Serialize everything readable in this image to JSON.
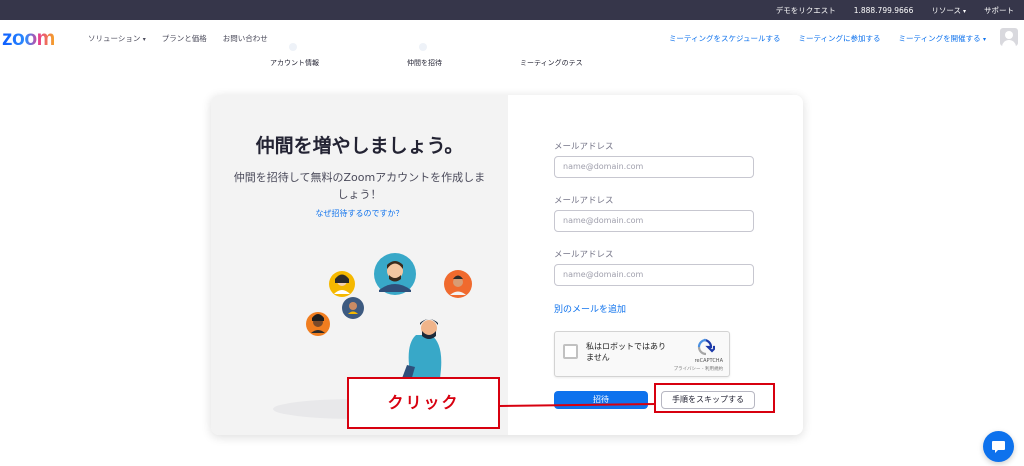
{
  "topbar": {
    "demo": "デモをリクエスト",
    "phone": "1.888.799.9666",
    "resources": "リソース",
    "support": "サポート"
  },
  "nav": {
    "logo": "zoom",
    "left": [
      "ソリューション",
      "プランと価格",
      "お問い合わせ"
    ],
    "right": [
      "ミーティングをスケジュールする",
      "ミーティングに参加する",
      "ミーティングを開催する"
    ]
  },
  "steps": [
    "アカウント情報",
    "仲間を招待",
    "ミーティングのテス"
  ],
  "invite": {
    "headline": "仲間を増やしましょう。",
    "subline": "仲間を招待して無料のZoomアカウントを作成しましょう！",
    "why_link": "なぜ招待するのですか？"
  },
  "form": {
    "fields": [
      {
        "label": "メールアドレス",
        "placeholder": "name@domain.com"
      },
      {
        "label": "メールアドレス",
        "placeholder": "name@domain.com"
      },
      {
        "label": "メールアドレス",
        "placeholder": "name@domain.com"
      }
    ],
    "add_email": "別のメールを追加",
    "recaptcha": {
      "text": "私はロボットではありません",
      "brand": "reCAPTCHA",
      "terms": "プライバシー - 利用規約"
    },
    "invite_button": "招待",
    "skip_button": "手順をスキップする"
  },
  "annotation": {
    "callout": "クリック",
    "color": "#d7000f"
  },
  "colors": {
    "accent": "#0e72ed",
    "topbar": "#36364a"
  },
  "icons": [
    "chevron-down-icon",
    "avatar-icon",
    "recaptcha-icon",
    "chat-icon"
  ]
}
